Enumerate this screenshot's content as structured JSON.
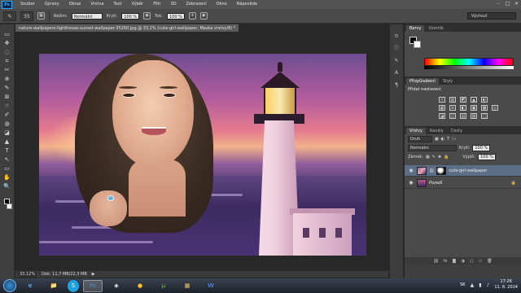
{
  "menubar": {
    "logo": "Ps",
    "items": [
      "Soubor",
      "Úpravy",
      "Obraz",
      "Vrstva",
      "Text",
      "Výběr",
      "Filtr",
      "3D",
      "Zobrazení",
      "Okno",
      "Nápověda"
    ],
    "controls": [
      "–",
      "□",
      "✕"
    ]
  },
  "options_bar": {
    "tool_icon": "brush-icon",
    "size": "35",
    "mode_label": "Režim:",
    "mode_value": "Normální",
    "opacity_label": "Krytí:",
    "opacity_value": "100 %",
    "flow_label": "Tok:",
    "flow_value": "100 %",
    "workspace": "Výchozí"
  },
  "document": {
    "tab_title": "nature-wallpapers-lighthouse-sunset-wallpaper-35260.jpg @ 33,1% (cute-girl-wallpaper, Maska vrstvy/8) *",
    "close": "×"
  },
  "status": {
    "zoom": "33,12%",
    "doc_size": "Dok: 11,7 MB/22,3 MB",
    "arrow": "▶"
  },
  "color_panel": {
    "tabs": [
      "Barvy",
      "Vzorník"
    ]
  },
  "adjustments_panel": {
    "tabs": [
      "Přizpůsobení",
      "Styly"
    ],
    "title": "Přidat nastavení",
    "row1": [
      "☼",
      "▥",
      "◩",
      "▲",
      "◐"
    ],
    "row2": [
      "▦",
      "⚖",
      "◧",
      "▣",
      "▩",
      "◎"
    ],
    "row3": [
      "◪",
      "◫",
      "▤",
      "▧",
      "□"
    ]
  },
  "layers_panel": {
    "tabs": [
      "Vrstvy",
      "Kanály",
      "Cesty"
    ],
    "kind_label": "Druh",
    "blend_mode": "Normální",
    "opacity_label": "Krytí:",
    "opacity_value": "100 %",
    "lock_label": "Zámek:",
    "fill_label": "Výplň:",
    "fill_value": "100 %",
    "layers": [
      {
        "name": "cute-girl-wallpaper",
        "selected": true
      },
      {
        "name": "Pozadí",
        "selected": false
      }
    ],
    "footer": [
      "⛓",
      "fx",
      "◙",
      "◑",
      "▢",
      "▭",
      "🗑"
    ]
  },
  "tools": [
    "▭",
    "✥",
    "◌",
    "⌗",
    "✂",
    "⊕",
    "✎",
    "⊞",
    "☝",
    "✐",
    "◍",
    "◪",
    "▲",
    "T",
    "↖",
    "▭",
    "✋",
    "🔍"
  ],
  "taskbar": {
    "apps": [
      "e",
      "📁",
      "S",
      "Ps",
      "◈",
      "●",
      "µ",
      "▦",
      "W"
    ],
    "active_index": 3,
    "language": "SK",
    "time": "17:26",
    "date": "11. 8. 2014"
  }
}
